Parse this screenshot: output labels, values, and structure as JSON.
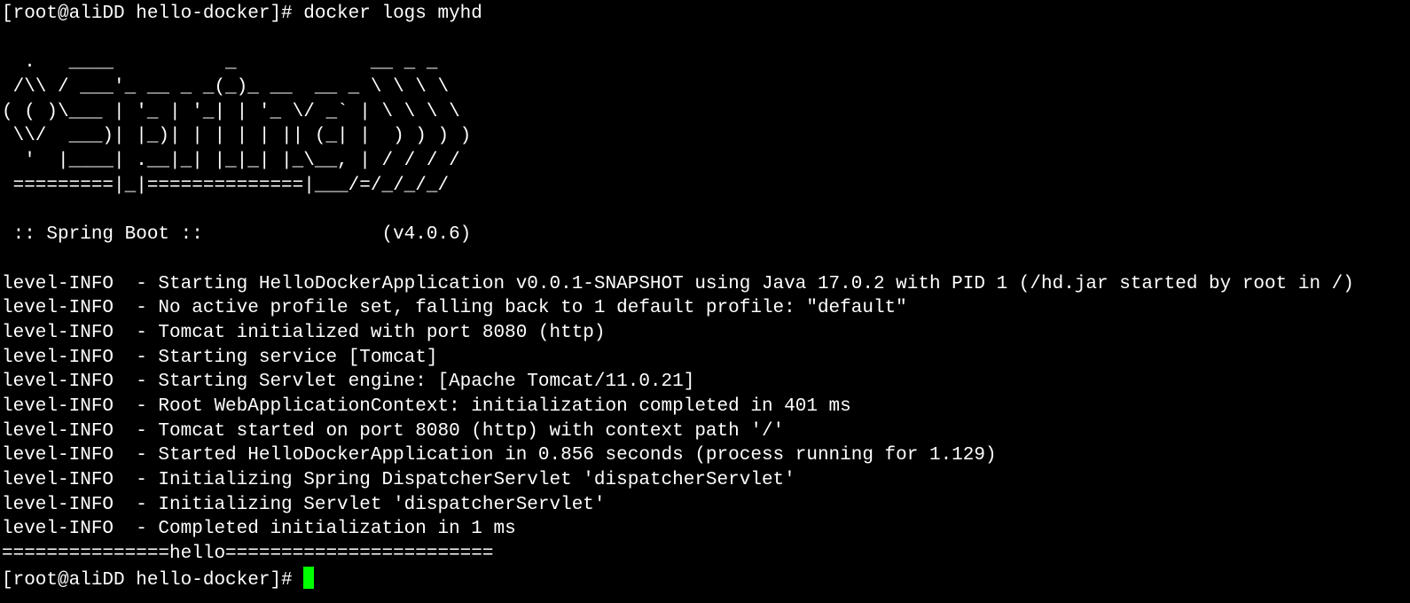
{
  "terminal": {
    "command_line": "[root@aliDD hello-docker]# docker logs myhd",
    "banner": [
      "  .   ____          _            __ _ _",
      " /\\\\ / ___'_ __ _ _(_)_ __  __ _ \\ \\ \\ \\",
      "( ( )\\___ | '_ | '_| | '_ \\/ _` | \\ \\ \\ \\",
      " \\\\/  ___)| |_)| | | | | || (_| |  ) ) ) )",
      "  '  |____| .__|_| |_|_| |_\\__, | / / / /",
      " =========|_|==============|___/=/_/_/_/"
    ],
    "spring_boot_line": " :: Spring Boot ::                (v4.0.6)",
    "log_lines": [
      "level-INFO  - Starting HelloDockerApplication v0.0.1-SNAPSHOT using Java 17.0.2 with PID 1 (/hd.jar started by root in /)",
      "level-INFO  - No active profile set, falling back to 1 default profile: \"default\"",
      "level-INFO  - Tomcat initialized with port 8080 (http)",
      "level-INFO  - Starting service [Tomcat]",
      "level-INFO  - Starting Servlet engine: [Apache Tomcat/11.0.21]",
      "level-INFO  - Root WebApplicationContext: initialization completed in 401 ms",
      "level-INFO  - Tomcat started on port 8080 (http) with context path '/'",
      "level-INFO  - Started HelloDockerApplication in 0.856 seconds (process running for 1.129)",
      "level-INFO  - Initializing Spring DispatcherServlet 'dispatcherServlet'",
      "level-INFO  - Initializing Servlet 'dispatcherServlet'",
      "level-INFO  - Completed initialization in 1 ms"
    ],
    "hello_line": "===============hello========================",
    "prompt": "[root@aliDD hello-docker]# ",
    "cursor_color": "#00ff00",
    "background_color": "#000000",
    "text_color": "#ffffff"
  }
}
